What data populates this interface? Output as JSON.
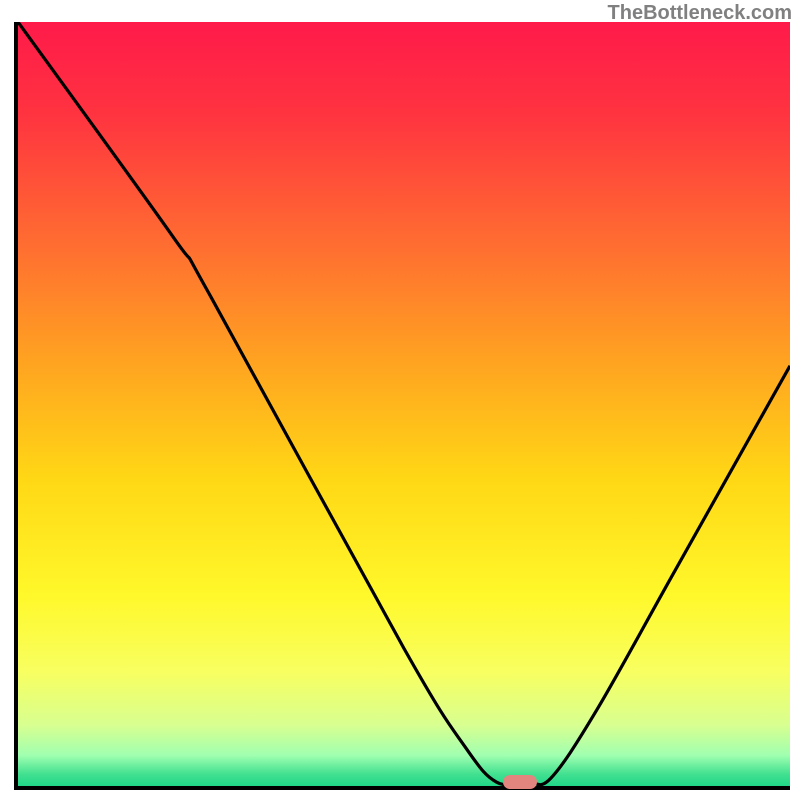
{
  "watermark": "TheBottleneck.com",
  "chart_data": {
    "type": "line",
    "title": "",
    "xlabel": "",
    "ylabel": "",
    "xlim": [
      0,
      100
    ],
    "ylim": [
      0,
      100
    ],
    "gradient": {
      "stops": [
        {
          "pos": 0.0,
          "color": "#ff1a4a"
        },
        {
          "pos": 0.12,
          "color": "#ff3340"
        },
        {
          "pos": 0.3,
          "color": "#ff7030"
        },
        {
          "pos": 0.45,
          "color": "#ffa520"
        },
        {
          "pos": 0.6,
          "color": "#ffd815"
        },
        {
          "pos": 0.75,
          "color": "#fff82a"
        },
        {
          "pos": 0.85,
          "color": "#f8ff60"
        },
        {
          "pos": 0.92,
          "color": "#d8ff90"
        },
        {
          "pos": 0.96,
          "color": "#a0ffb0"
        },
        {
          "pos": 0.985,
          "color": "#40e090"
        },
        {
          "pos": 1.0,
          "color": "#20d888"
        }
      ]
    },
    "curve": [
      {
        "x": 0,
        "y": 100
      },
      {
        "x": 20,
        "y": 72
      },
      {
        "x": 25,
        "y": 64
      },
      {
        "x": 50,
        "y": 18
      },
      {
        "x": 58,
        "y": 5
      },
      {
        "x": 62,
        "y": 0.5
      },
      {
        "x": 66,
        "y": 0.5
      },
      {
        "x": 69,
        "y": 1
      },
      {
        "x": 75,
        "y": 10
      },
      {
        "x": 85,
        "y": 28
      },
      {
        "x": 100,
        "y": 55
      }
    ],
    "marker": {
      "x": 65,
      "y": 0.5,
      "color": "#e2857e"
    }
  }
}
